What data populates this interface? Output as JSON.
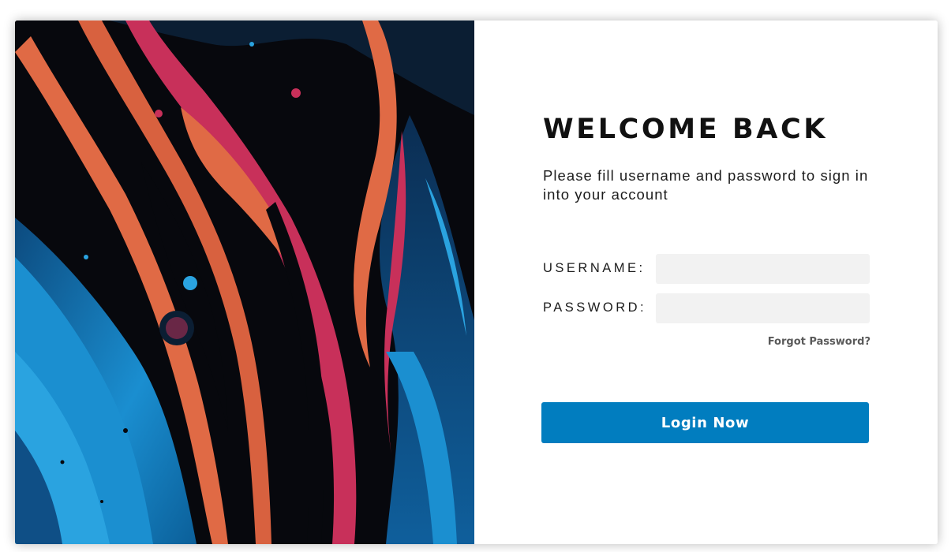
{
  "login": {
    "title": "WELCOME BACK",
    "subtitle": "Please fill username and password to sign in into your account",
    "username_label": "USERNAME:",
    "username_value": "",
    "username_placeholder": "",
    "password_label": "PASSWORD:",
    "password_value": "",
    "password_placeholder": "",
    "forgot_label": "Forgot Password?",
    "submit_label": "Login Now"
  },
  "theme": {
    "accent": "#017dbf",
    "input_background": "#f2f2f2",
    "title_color": "#111111"
  },
  "hero_image": {
    "description_icon": "abstract-fluid-art-image",
    "palette": [
      "#07080d",
      "#0a3a66",
      "#1b8fd0",
      "#e06a45",
      "#c8305a"
    ]
  }
}
